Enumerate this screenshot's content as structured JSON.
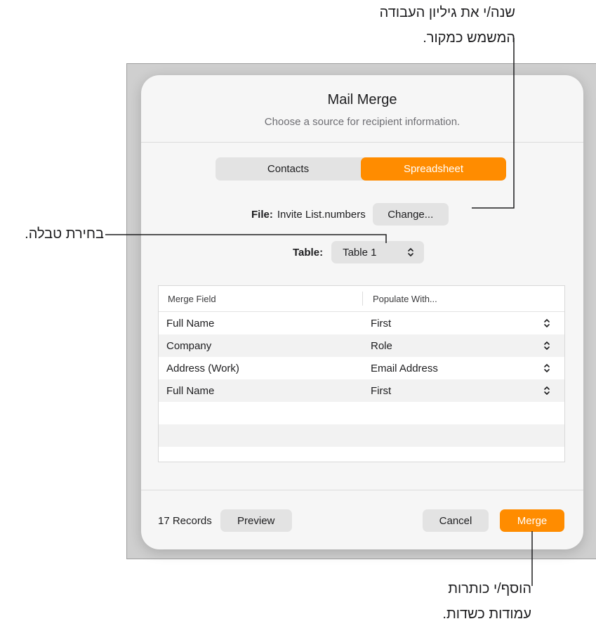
{
  "callouts": {
    "top_line1": "שנה/י את גיליון העבודה",
    "top_line2": "המשמש כמקור.",
    "left": "בחירת טבלה.",
    "bottom_line1": "הוסף/י כותרות",
    "bottom_line2": "עמודות כשדות."
  },
  "dialog": {
    "title": "Mail Merge",
    "subtitle": "Choose a source for recipient information.",
    "tabs": [
      {
        "label": "Contacts",
        "active": false
      },
      {
        "label": "Spreadsheet",
        "active": true
      }
    ],
    "file_label": "File:",
    "file_value": "Invite List.numbers",
    "change_button": "Change...",
    "table_label": "Table:",
    "table_value": "Table 1",
    "grid": {
      "headers": [
        "Merge Field",
        "Populate With..."
      ],
      "rows": [
        {
          "field": "Full Name",
          "populate": "First"
        },
        {
          "field": "Company",
          "populate": "Role"
        },
        {
          "field": "Address (Work)",
          "populate": "Email Address"
        },
        {
          "field": "Full Name",
          "populate": "First"
        }
      ]
    },
    "records": "17 Records",
    "preview_button": "Preview",
    "cancel_button": "Cancel",
    "merge_button": "Merge"
  },
  "colors": {
    "accent": "#ff8c00"
  },
  "icons": {
    "popup": "up-down-chevron-icon"
  }
}
